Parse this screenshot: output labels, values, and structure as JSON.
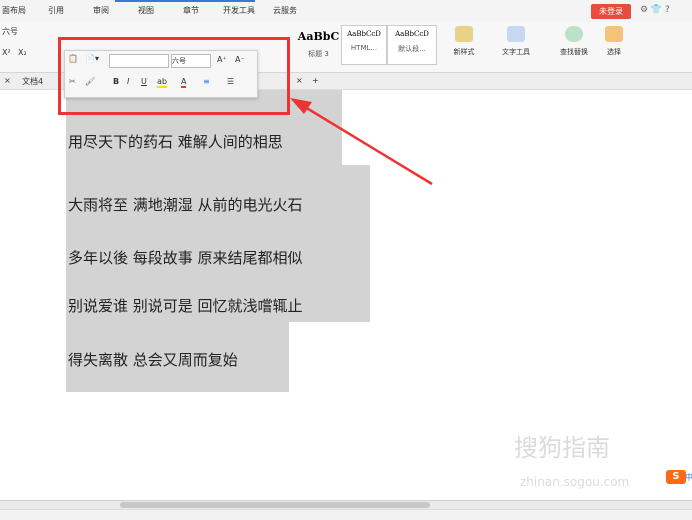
{
  "menu": {
    "tabs": [
      "面布局",
      "引用",
      "审阅",
      "视图",
      "章节",
      "开发工具",
      "云服务"
    ],
    "login": "未登录",
    "right_icons": "⚙ 👕 ?"
  },
  "ribbon": {
    "font_size": "六号",
    "superscript": "X²",
    "subscript": "X₂",
    "styles": [
      {
        "preview": "AaBbC",
        "name": "标题 3"
      },
      {
        "preview": "AaBbCcD",
        "name": "HTML..."
      },
      {
        "preview": "AaBbCcD",
        "name": "默认段..."
      }
    ],
    "new_style": "新样式",
    "text_tools": "文字工具",
    "find_replace": "查找替换",
    "select": "选择"
  },
  "tabbar": {
    "close": "×",
    "doc_tab": "文档4",
    "tab_close": "×",
    "add": "+"
  },
  "mini_toolbar": {
    "font_size_value": "六号",
    "grow": "A⁺",
    "shrink": "A⁻",
    "bold": "B",
    "italic": "I",
    "underline": "U",
    "highlight": "ab",
    "font_color": "A",
    "align": "≡",
    "list": "☰"
  },
  "document": {
    "lines": [
      "用尽天下的药石  难解人间的相思",
      "大雨将至  满地潮湿  从前的电光火石",
      "多年以後  每段故事  原来结尾都相似",
      "别说爱谁  别说可是  回忆就浅嚐辄止",
      "得失离散  总会又周而复始"
    ]
  },
  "watermark": {
    "text": "搜狗指南",
    "url": "zhinan.sogou.com"
  },
  "ime": {
    "logo": "S",
    "tail": "中"
  },
  "colors": {
    "accent": "#3a78d8",
    "annotation": "#e33333",
    "selection": "#d3d3d3"
  }
}
